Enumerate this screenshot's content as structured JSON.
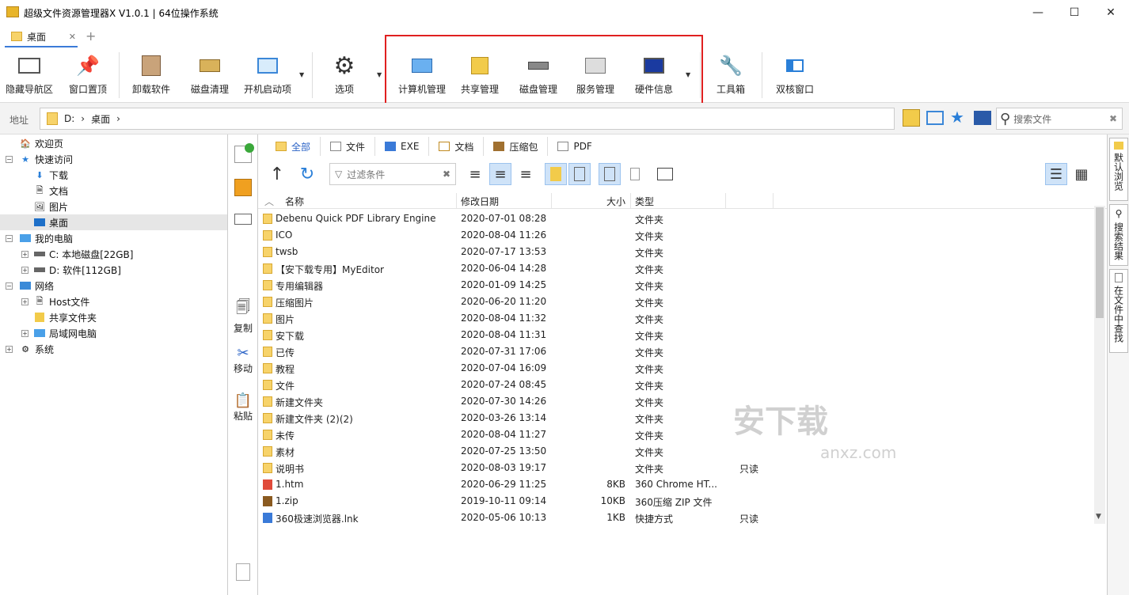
{
  "window": {
    "title": "超级文件资源管理器X V1.0.1 | 64位操作系统",
    "minimize": "—",
    "maximize": "☐",
    "close": "✕"
  },
  "tabs": [
    {
      "label": "桌面",
      "close": "✕"
    }
  ],
  "tab_add": "+",
  "toolbar": {
    "hide_nav": "隐藏导航区",
    "pin_window": "窗口置顶",
    "uninstall": "卸载软件",
    "disk_clean": "磁盘清理",
    "startup": "开机启动项",
    "options": "选项",
    "computer_mgmt": "计算机管理",
    "share_mgmt": "共享管理",
    "disk_mgmt": "磁盘管理",
    "service_mgmt": "服务管理",
    "hardware_info": "硬件信息",
    "toolbox": "工具箱",
    "dual_window": "双核窗口"
  },
  "address": {
    "label": "地址",
    "crumbs": [
      "D:",
      "桌面"
    ],
    "search_placeholder": "搜索文件"
  },
  "nav_tree": {
    "welcome": "欢迎页",
    "quick_access": "快速访问",
    "downloads": "下载",
    "documents": "文档",
    "pictures": "图片",
    "desktop": "桌面",
    "my_computer": "我的电脑",
    "drive_c": "C: 本地磁盘[22GB]",
    "drive_d": "D: 软件[112GB]",
    "network": "网络",
    "host_files": "Host文件",
    "shared_folder": "共享文件夹",
    "lan_pc": "局域网电脑",
    "system": "系统"
  },
  "mid_actions": {
    "copy": "复制",
    "move": "移动",
    "paste": "粘贴"
  },
  "type_tabs": [
    "全部",
    "文件",
    "EXE",
    "文档",
    "压缩包",
    "PDF"
  ],
  "filter_placeholder": "过滤条件",
  "columns": {
    "name": "名称",
    "modified": "修改日期",
    "size": "大小",
    "type": "类型"
  },
  "files": [
    {
      "name": "Debenu Quick PDF Library Engine",
      "date": "2020-07-01 08:28",
      "size": "",
      "type": "文件夹",
      "attr": "",
      "kind": "folder"
    },
    {
      "name": "ICO",
      "date": "2020-08-04 11:26",
      "size": "",
      "type": "文件夹",
      "attr": "",
      "kind": "folder"
    },
    {
      "name": "twsb",
      "date": "2020-07-17 13:53",
      "size": "",
      "type": "文件夹",
      "attr": "",
      "kind": "folder"
    },
    {
      "name": "【安下载专用】MyEditor",
      "date": "2020-06-04 14:28",
      "size": "",
      "type": "文件夹",
      "attr": "",
      "kind": "folder"
    },
    {
      "name": "专用编辑器",
      "date": "2020-01-09 14:25",
      "size": "",
      "type": "文件夹",
      "attr": "",
      "kind": "folder"
    },
    {
      "name": "压缩图片",
      "date": "2020-06-20 11:20",
      "size": "",
      "type": "文件夹",
      "attr": "",
      "kind": "folder"
    },
    {
      "name": "图片",
      "date": "2020-08-04 11:32",
      "size": "",
      "type": "文件夹",
      "attr": "",
      "kind": "folder"
    },
    {
      "name": "安下载",
      "date": "2020-08-04 11:31",
      "size": "",
      "type": "文件夹",
      "attr": "",
      "kind": "folder"
    },
    {
      "name": "已传",
      "date": "2020-07-31 17:06",
      "size": "",
      "type": "文件夹",
      "attr": "",
      "kind": "folder"
    },
    {
      "name": "教程",
      "date": "2020-07-04 16:09",
      "size": "",
      "type": "文件夹",
      "attr": "",
      "kind": "folder"
    },
    {
      "name": "文件",
      "date": "2020-07-24 08:45",
      "size": "",
      "type": "文件夹",
      "attr": "",
      "kind": "folder"
    },
    {
      "name": "新建文件夹",
      "date": "2020-07-30 14:26",
      "size": "",
      "type": "文件夹",
      "attr": "",
      "kind": "folder"
    },
    {
      "name": "新建文件夹 (2)(2)",
      "date": "2020-03-26 13:14",
      "size": "",
      "type": "文件夹",
      "attr": "",
      "kind": "folder"
    },
    {
      "name": "未传",
      "date": "2020-08-04 11:27",
      "size": "",
      "type": "文件夹",
      "attr": "",
      "kind": "folder"
    },
    {
      "name": "素材",
      "date": "2020-07-25 13:50",
      "size": "",
      "type": "文件夹",
      "attr": "",
      "kind": "folder"
    },
    {
      "name": "说明书",
      "date": "2020-08-03 19:17",
      "size": "",
      "type": "文件夹",
      "attr": "只读",
      "kind": "folder"
    },
    {
      "name": "1.htm",
      "date": "2020-06-29 11:25",
      "size": "8KB",
      "type": "360 Chrome HT...",
      "attr": "",
      "kind": "htm"
    },
    {
      "name": "1.zip",
      "date": "2019-10-11 09:14",
      "size": "10KB",
      "type": "360压缩 ZIP 文件",
      "attr": "",
      "kind": "zip"
    },
    {
      "name": "360极速浏览器.lnk",
      "date": "2020-05-06 10:13",
      "size": "1KB",
      "type": "快捷方式",
      "attr": "只读",
      "kind": "lnk"
    }
  ],
  "right_tabs": [
    "默认浏览",
    "搜索结果",
    "在文件中查找"
  ],
  "watermark": {
    "main": "安下载",
    "sub": "anxz.com"
  },
  "colors": {
    "accent": "#2a62c6",
    "folder": "#f7d36a",
    "highlight_box": "#e02020"
  }
}
